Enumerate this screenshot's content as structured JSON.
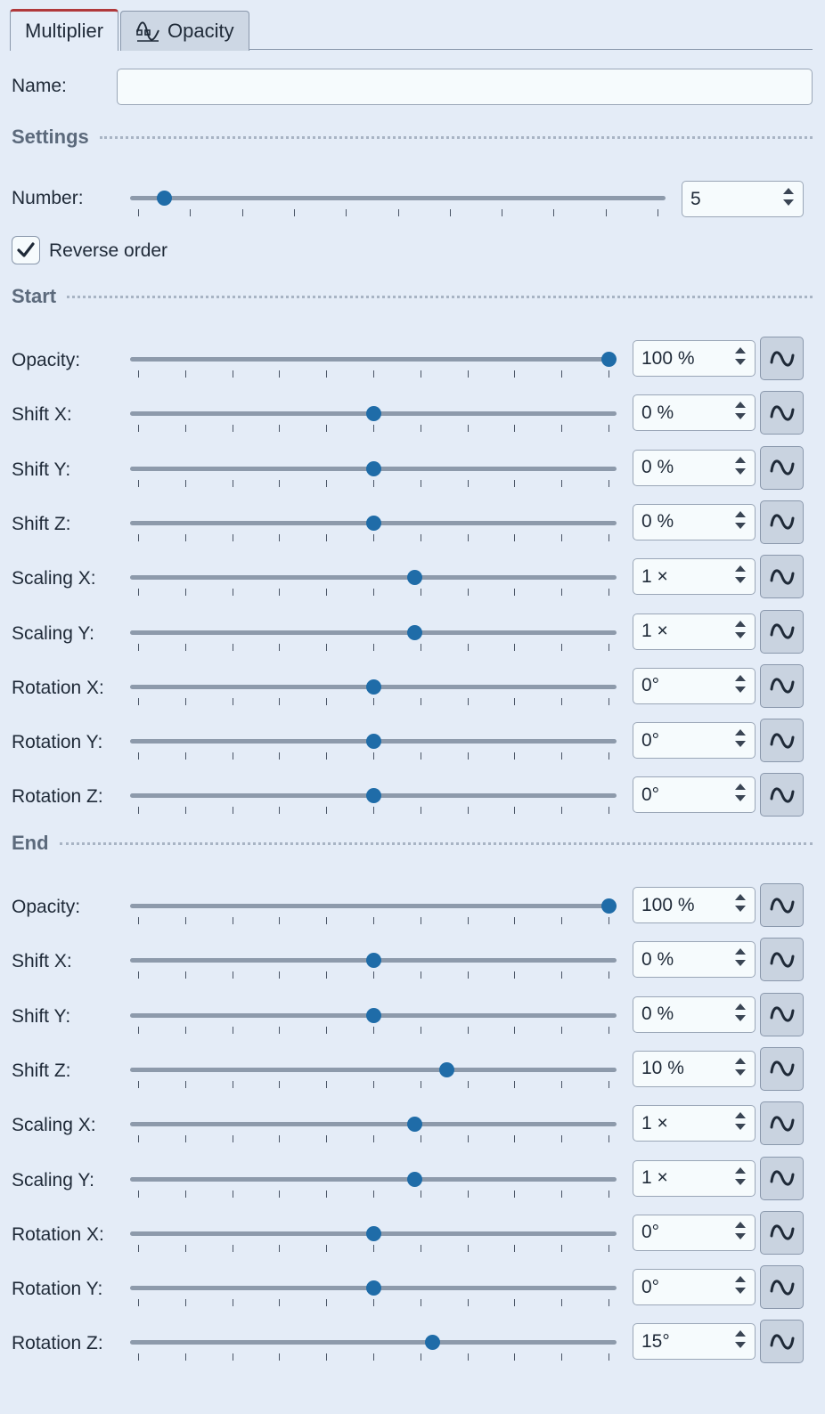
{
  "tabs": [
    {
      "label": "Multiplier",
      "active": true
    },
    {
      "label": "Opacity",
      "active": false,
      "icon": "keyframe-curve-icon"
    }
  ],
  "name_field": {
    "label": "Name:",
    "value": "",
    "placeholder": ""
  },
  "settings": {
    "title": "Settings",
    "number": {
      "label": "Number:",
      "value": "5",
      "slider_fraction": 0.05
    },
    "reverse_order": {
      "label": "Reverse order",
      "checked": true
    }
  },
  "start": {
    "title": "Start",
    "rows": [
      {
        "label": "Opacity:",
        "value": "100 %",
        "slider_fraction": 1.0
      },
      {
        "label": "Shift X:",
        "value": "0 %",
        "slider_fraction": 0.5
      },
      {
        "label": "Shift Y:",
        "value": "0 %",
        "slider_fraction": 0.5
      },
      {
        "label": "Shift Z:",
        "value": "0 %",
        "slider_fraction": 0.5
      },
      {
        "label": "Scaling X:",
        "value": "1 ×",
        "slider_fraction": 0.587
      },
      {
        "label": "Scaling Y:",
        "value": "1 ×",
        "slider_fraction": 0.587
      },
      {
        "label": "Rotation X:",
        "value": "0°",
        "slider_fraction": 0.5
      },
      {
        "label": "Rotation Y:",
        "value": "0°",
        "slider_fraction": 0.5
      },
      {
        "label": "Rotation Z:",
        "value": "0°",
        "slider_fraction": 0.5
      }
    ]
  },
  "end": {
    "title": "End",
    "rows": [
      {
        "label": "Opacity:",
        "value": "100 %",
        "slider_fraction": 1.0
      },
      {
        "label": "Shift X:",
        "value": "0 %",
        "slider_fraction": 0.5
      },
      {
        "label": "Shift Y:",
        "value": "0 %",
        "slider_fraction": 0.5
      },
      {
        "label": "Shift Z:",
        "value": "10 %",
        "slider_fraction": 0.656
      },
      {
        "label": "Scaling X:",
        "value": "1 ×",
        "slider_fraction": 0.587
      },
      {
        "label": "Scaling Y:",
        "value": "1 ×",
        "slider_fraction": 0.587
      },
      {
        "label": "Rotation X:",
        "value": "0°",
        "slider_fraction": 0.5
      },
      {
        "label": "Rotation Y:",
        "value": "0°",
        "slider_fraction": 0.5
      },
      {
        "label": "Rotation Z:",
        "value": "15°",
        "slider_fraction": 0.625
      }
    ]
  },
  "colors": {
    "background": "#e4ecf7",
    "accent": "#1f6ca8",
    "active_tab_border": "#b0383b"
  },
  "icons": {
    "curve_button": "sine-wave-icon",
    "checkbox": "checkmark-icon"
  }
}
